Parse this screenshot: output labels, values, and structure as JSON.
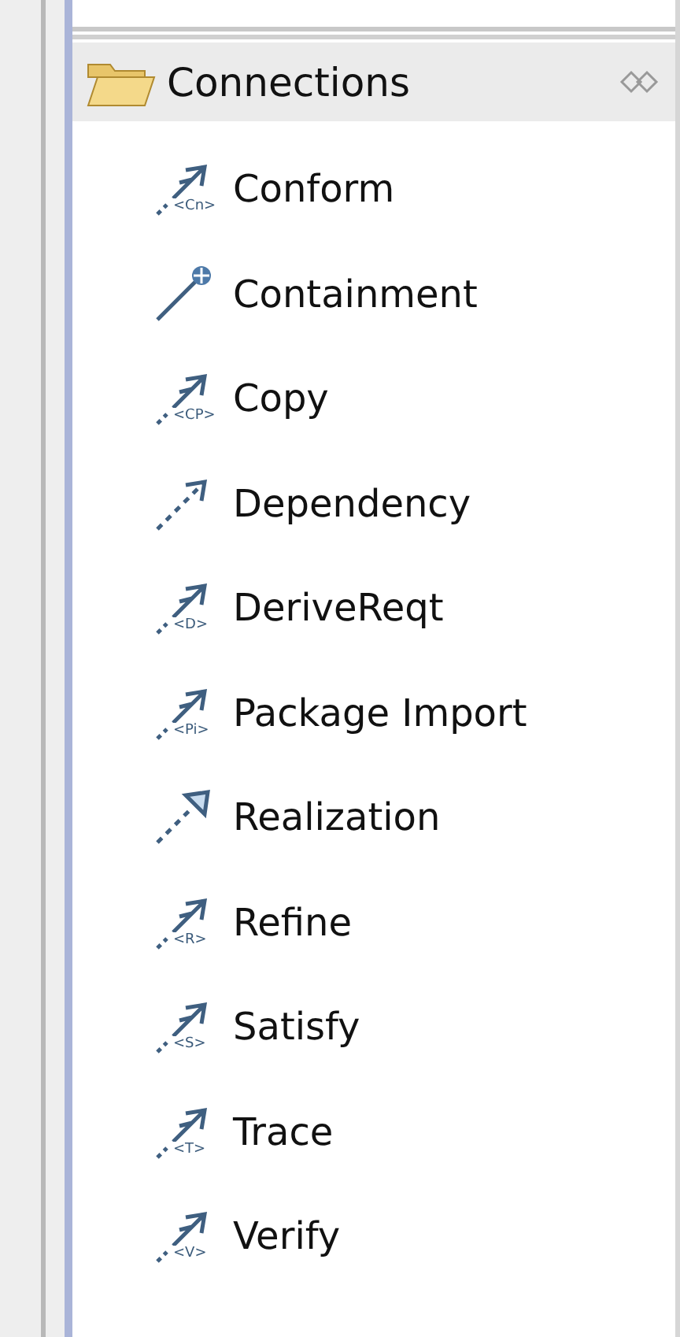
{
  "drawer": {
    "title": "Connections",
    "expanded": true
  },
  "tools": [
    {
      "label": "Conform",
      "kind": "stereotype",
      "tag": "<Cn>"
    },
    {
      "label": "Containment",
      "kind": "containment"
    },
    {
      "label": "Copy",
      "kind": "stereotype",
      "tag": "<CP>"
    },
    {
      "label": "Dependency",
      "kind": "dependency"
    },
    {
      "label": "DeriveReqt",
      "kind": "stereotype",
      "tag": "<D>"
    },
    {
      "label": "Package Import",
      "kind": "stereotype",
      "tag": "<Pi>"
    },
    {
      "label": "Realization",
      "kind": "realization"
    },
    {
      "label": "Refine",
      "kind": "stereotype",
      "tag": "<R>"
    },
    {
      "label": "Satisfy",
      "kind": "stereotype",
      "tag": "<S>"
    },
    {
      "label": "Trace",
      "kind": "stereotype",
      "tag": "<T>"
    },
    {
      "label": "Verify",
      "kind": "stereotype",
      "tag": "<V>"
    }
  ]
}
